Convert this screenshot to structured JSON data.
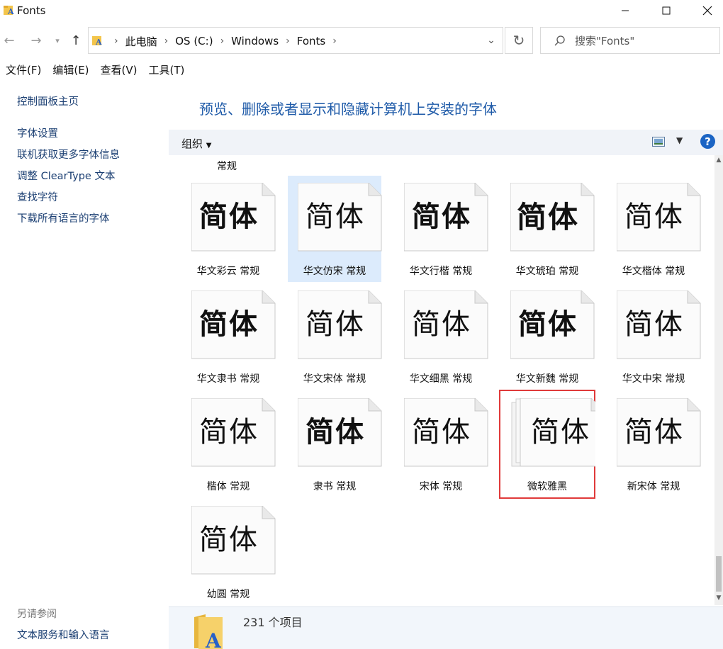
{
  "window": {
    "title": "Fonts"
  },
  "nav": {
    "breadcrumbs": [
      "此电脑",
      "OS (C:)",
      "Windows",
      "Fonts"
    ],
    "search_placeholder": "搜索\"Fonts\""
  },
  "menu": [
    "文件(F)",
    "编辑(E)",
    "查看(V)",
    "工具(T)"
  ],
  "sidebar": {
    "links": [
      "控制面板主页",
      "字体设置",
      "联机获取更多字体信息",
      "调整 ClearType 文本",
      "查找字符",
      "下载所有语言的字体"
    ],
    "see_also_title": "另请参阅",
    "see_also_links": [
      "文本服务和输入语言"
    ]
  },
  "main": {
    "heading": "预览、删除或者显示和隐藏计算机上安装的字体",
    "organize_label": "组织",
    "partial_label": "常规",
    "fonts": [
      {
        "sample": "简体",
        "label": "华文彩云 常规"
      },
      {
        "sample": "简体",
        "label": "华文仿宋 常规"
      },
      {
        "sample": "简体",
        "label": "华文行楷 常规"
      },
      {
        "sample": "简体",
        "label": "华文琥珀 常规"
      },
      {
        "sample": "简体",
        "label": "华文楷体 常规"
      },
      {
        "sample": "简体",
        "label": "华文隶书 常规"
      },
      {
        "sample": "简体",
        "label": "华文宋体 常规"
      },
      {
        "sample": "简体",
        "label": "华文细黑 常规"
      },
      {
        "sample": "简体",
        "label": "华文新魏 常规"
      },
      {
        "sample": "简体",
        "label": "华文中宋 常规"
      },
      {
        "sample": "简体",
        "label": "楷体 常规"
      },
      {
        "sample": "简体",
        "label": "隶书 常规"
      },
      {
        "sample": "简体",
        "label": "宋体 常规"
      },
      {
        "sample": "简体",
        "label": "微软雅黑"
      },
      {
        "sample": "简体",
        "label": "新宋体 常规"
      },
      {
        "sample": "简体",
        "label": "幼圆 常规"
      }
    ]
  },
  "status": {
    "item_count": "231 个项目"
  },
  "colors": {
    "link": "#1a3e72",
    "heading": "#1e5aa8",
    "selection": "#dcebfc",
    "highlight_box": "#e03a3a",
    "help": "#1b64c4"
  }
}
